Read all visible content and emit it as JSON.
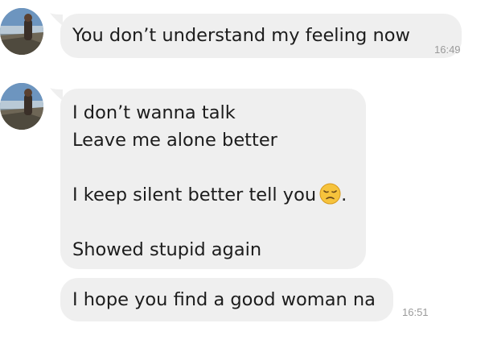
{
  "messages": [
    {
      "lines": [
        "You don’t understand my feeling now"
      ],
      "time": "16:49"
    },
    {
      "line1": "I don’t wanna talk",
      "line2": "Leave me alone better",
      "line3": "I keep silent better tell you",
      "line3_suffix": ".",
      "line3_emoji": "pensive-face-emoji",
      "line4": "Showed stupid again"
    },
    {
      "lines": [
        "I hope you find a good woman na"
      ],
      "time": "16:51"
    }
  ],
  "colors": {
    "bubble": "#efefef",
    "text": "#1c1c1c",
    "timestamp": "#9a9a9a",
    "emoji": "#f6c33c"
  }
}
